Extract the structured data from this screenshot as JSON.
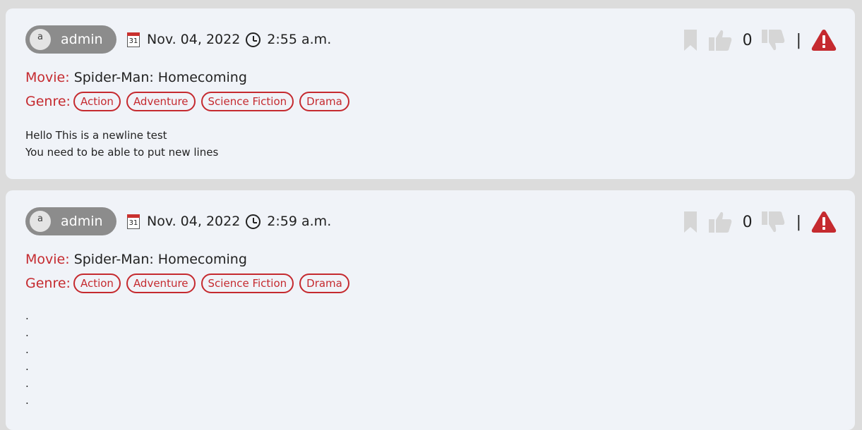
{
  "reviews": [
    {
      "user": {
        "avatar": "a",
        "name": "admin"
      },
      "date": "Nov. 04, 2022",
      "time": "2:55 a.m.",
      "calendar_day": "31",
      "vote_count": "0",
      "separator": "|",
      "movie_label": "Movie:",
      "movie_title": "Spider-Man: Homecoming",
      "genre_label": "Genre:",
      "genres": [
        "Action",
        "Adventure",
        "Science Fiction",
        "Drama"
      ],
      "text_lines": [
        "Hello This is a newline test",
        "You need to be able to put new lines"
      ]
    },
    {
      "user": {
        "avatar": "a",
        "name": "admin"
      },
      "date": "Nov. 04, 2022",
      "time": "2:59 a.m.",
      "calendar_day": "31",
      "vote_count": "0",
      "separator": "|",
      "movie_label": "Movie:",
      "movie_title": "Spider-Man: Homecoming",
      "genre_label": "Genre:",
      "genres": [
        "Action",
        "Adventure",
        "Science Fiction",
        "Drama"
      ],
      "text_lines": [
        ".",
        ".",
        ".",
        ".",
        ".",
        "."
      ]
    }
  ],
  "colors": {
    "accent_red": "#c52a2f",
    "card_bg": "#f0f3f8",
    "page_bg": "#dcdcdc",
    "icon_grey": "#d6d6d6",
    "pill_grey": "#8c8c8c"
  },
  "icons": {
    "calendar": "calendar-icon",
    "clock": "clock-icon",
    "bookmark": "bookmark-icon",
    "like": "thumbs-up-icon",
    "dislike": "thumbs-down-icon",
    "report": "warning-icon"
  }
}
